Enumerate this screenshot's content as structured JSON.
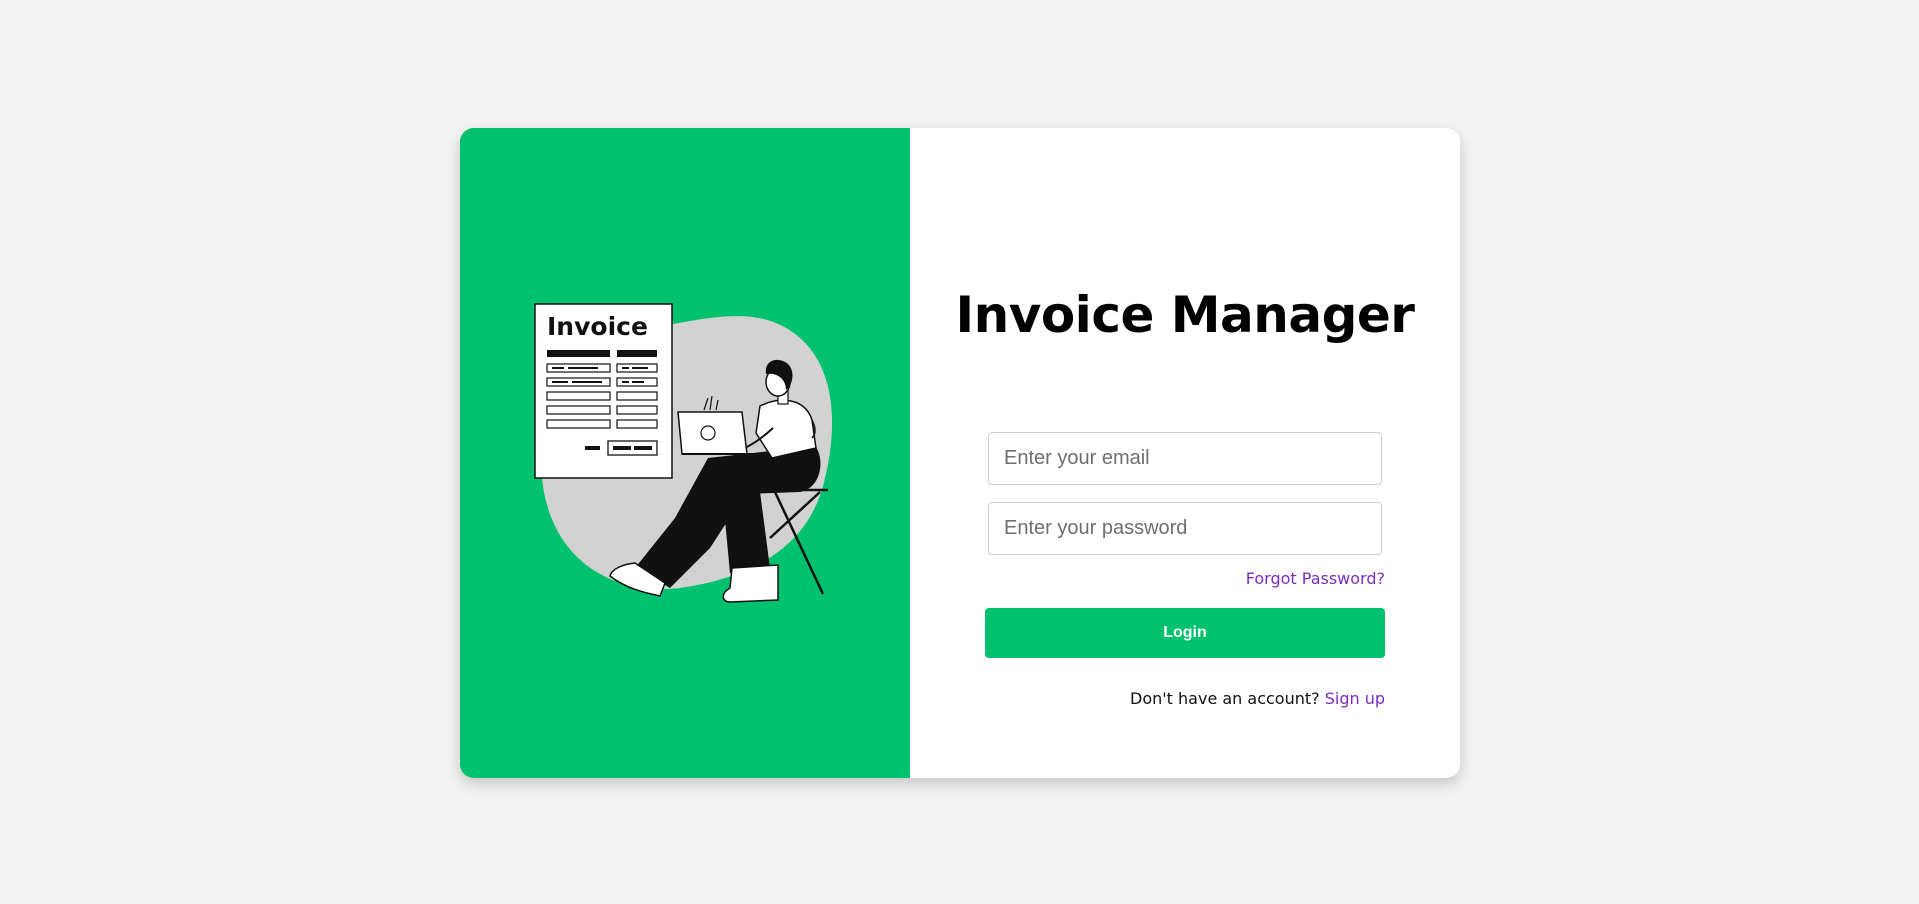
{
  "colors": {
    "page_background": "#f2f2f2",
    "brand_green": "#00c16e",
    "link_purple": "#7b2cbf",
    "blob_gray": "#d2d2d2"
  },
  "illustration": {
    "icon": "person-with-laptop-and-invoice-illustration",
    "document_heading": "Invoice"
  },
  "login": {
    "title": "Invoice Manager",
    "email_placeholder": "Enter your email",
    "email_value": "",
    "password_placeholder": "Enter your password",
    "password_value": "",
    "forgot_password": "Forgot Password?",
    "login_button": "Login",
    "signup_prompt": "Don't have an account?",
    "signup_link": "Sign up"
  }
}
